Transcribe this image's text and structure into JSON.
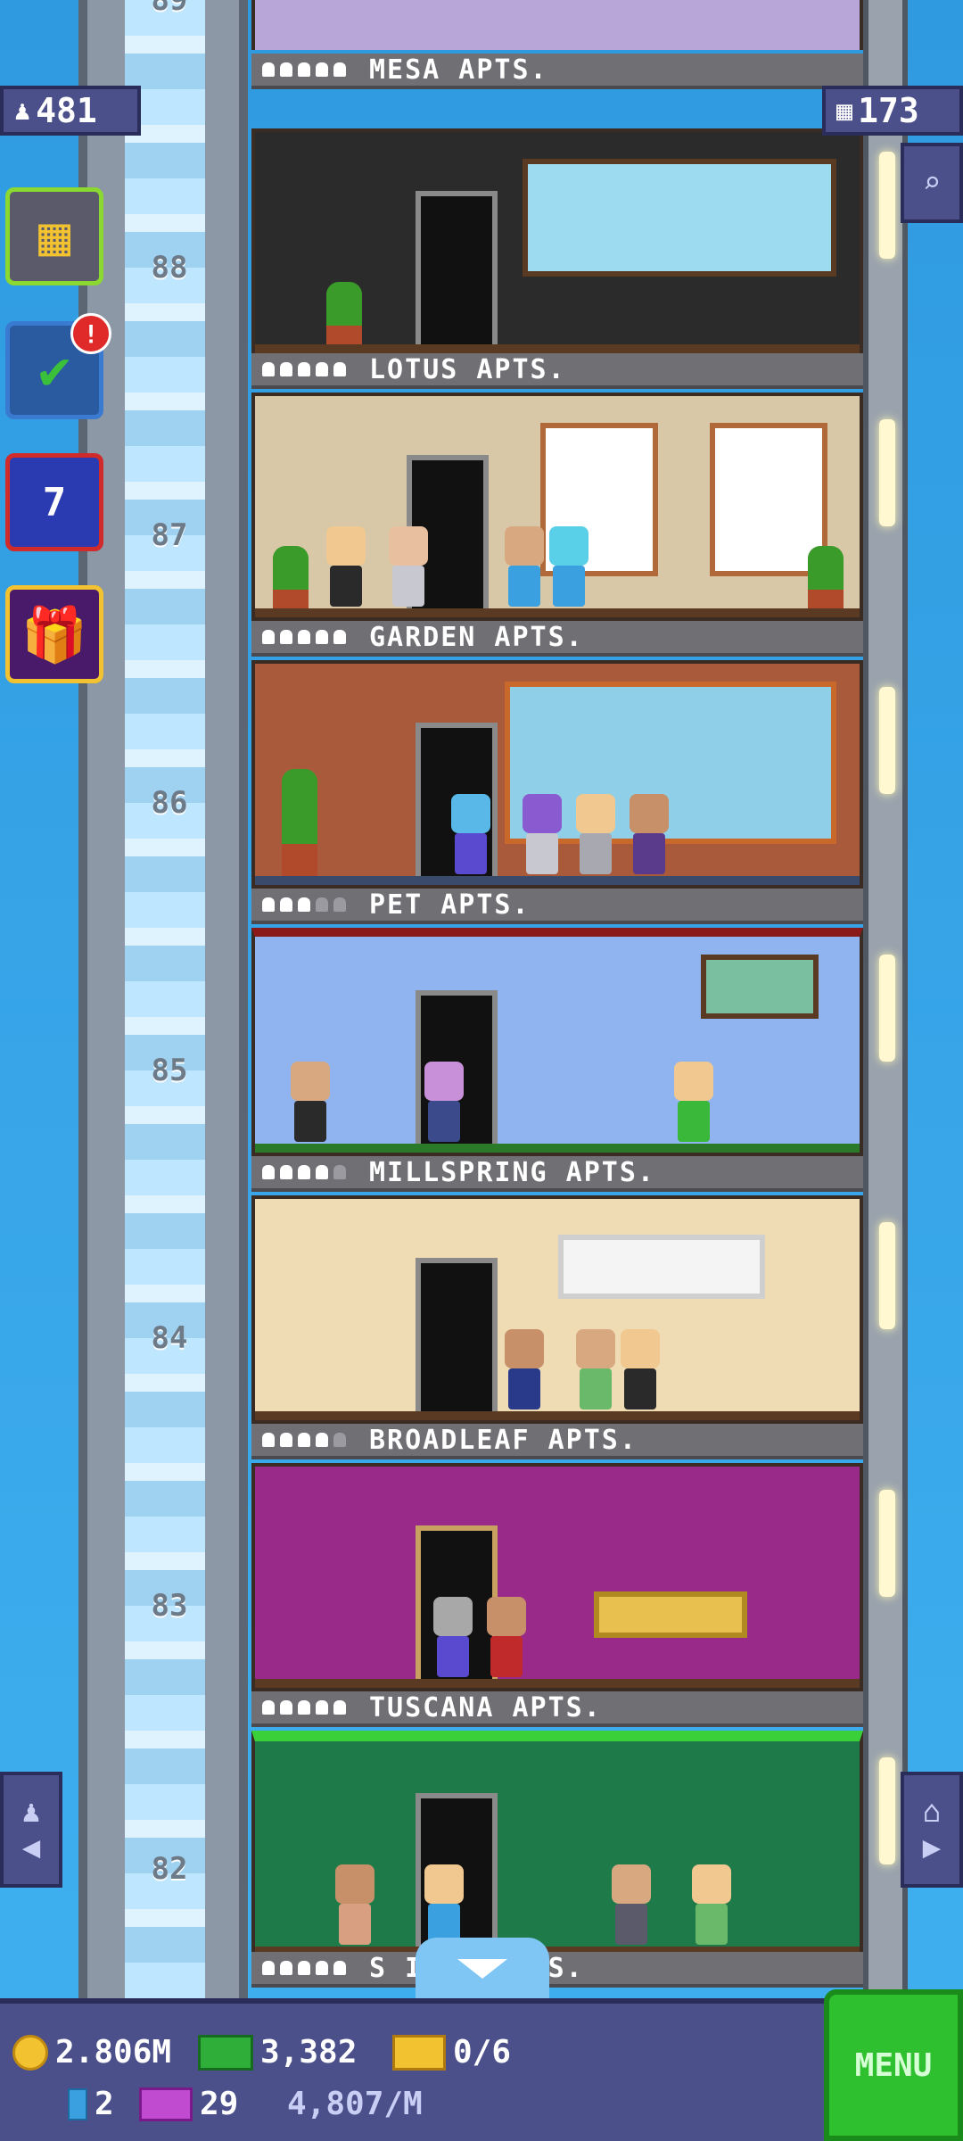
{
  "top": {
    "population": "481",
    "floor_count": "173",
    "top_sign": "MESA APTS."
  },
  "floors": [
    {
      "name": "LOTUS APTS.",
      "level": "88",
      "stars": 5
    },
    {
      "name": "GARDEN APTS.",
      "level": "87",
      "stars": 5
    },
    {
      "name": "PET APTS.",
      "level": "86",
      "stars": 3
    },
    {
      "name": "MILLSPRING APTS.",
      "level": "85",
      "stars": 4
    },
    {
      "name": "BROADLEAF APTS.",
      "level": "84",
      "stars": 4
    },
    {
      "name": "TUSCANA APTS.",
      "level": "83",
      "stars": 5
    },
    {
      "name": "S IELD APTS.",
      "level": "82",
      "stars": 5
    }
  ],
  "shaft_top_label": "89",
  "side_buttons": {
    "notification_count": "!",
    "calendar_day": "7"
  },
  "bottom": {
    "coins": "2.806M",
    "bux": "3,382",
    "tickets": "0/6",
    "elevators": "2",
    "vip": "29",
    "income_rate": "4,807/M",
    "menu_label": "MENU"
  },
  "colors": {
    "room_lotus": "#2b2b2b",
    "room_garden": "#d8c8a8",
    "room_pet": "#a85a3a",
    "room_millspring": "#8fb4f0",
    "room_broadleaf": "#f0dcb4",
    "room_tuscana": "#9a2a8a",
    "room_shield": "#1f7a4a"
  }
}
